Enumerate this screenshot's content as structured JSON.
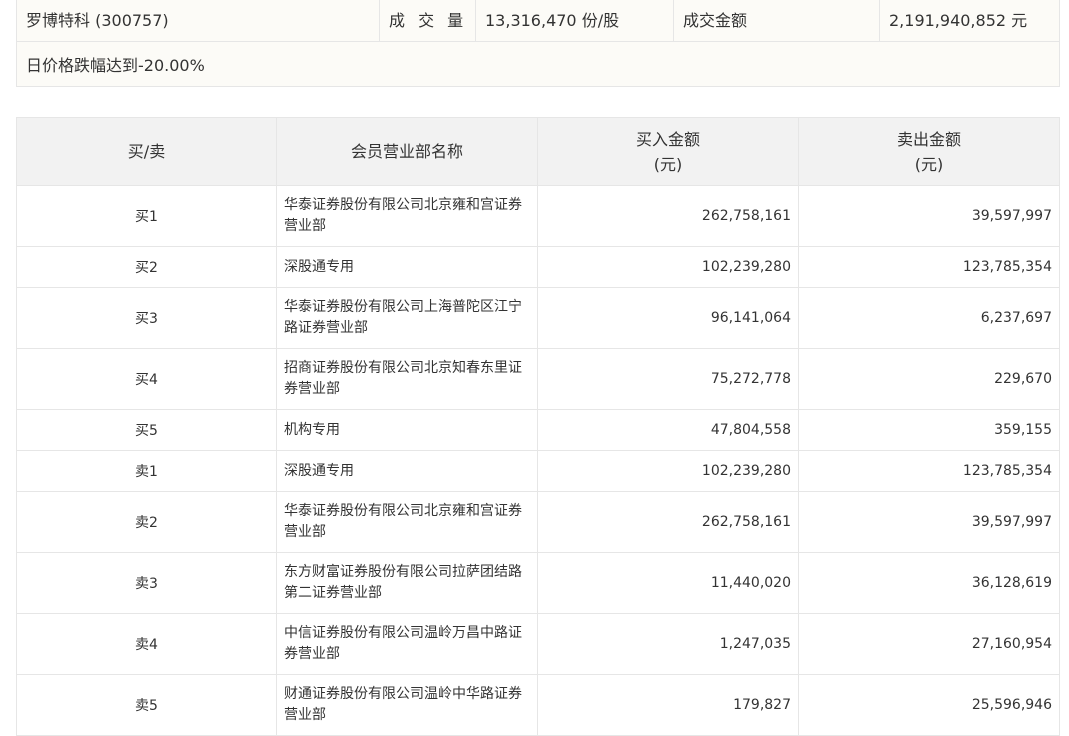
{
  "summary": {
    "stock_name": "罗博特科 (300757)",
    "volume_label": "成 交 量",
    "volume_value": "13,316,470 份/股",
    "amount_label": "成交金额",
    "amount_value": "2,191,940,852 元",
    "reason": "日价格跌幅达到-20.00%"
  },
  "table": {
    "headers": {
      "side": "买/卖",
      "dept": "会员营业部名称",
      "buy": "买入金额",
      "buy_unit": "(元)",
      "sell": "卖出金额",
      "sell_unit": "(元)"
    },
    "rows": [
      {
        "side": "买1",
        "dept": "华泰证券股份有限公司北京雍和宫证券营业部",
        "buy": "262,758,161",
        "sell": "39,597,997"
      },
      {
        "side": "买2",
        "dept": "深股通专用",
        "buy": "102,239,280",
        "sell": "123,785,354"
      },
      {
        "side": "买3",
        "dept": "华泰证券股份有限公司上海普陀区江宁路证券营业部",
        "buy": "96,141,064",
        "sell": "6,237,697"
      },
      {
        "side": "买4",
        "dept": "招商证券股份有限公司北京知春东里证券营业部",
        "buy": "75,272,778",
        "sell": "229,670"
      },
      {
        "side": "买5",
        "dept": "机构专用",
        "buy": "47,804,558",
        "sell": "359,155"
      },
      {
        "side": "卖1",
        "dept": "深股通专用",
        "buy": "102,239,280",
        "sell": "123,785,354"
      },
      {
        "side": "卖2",
        "dept": "华泰证券股份有限公司北京雍和宫证券营业部",
        "buy": "262,758,161",
        "sell": "39,597,997"
      },
      {
        "side": "卖3",
        "dept": "东方财富证券股份有限公司拉萨团结路第二证券营业部",
        "buy": "11,440,020",
        "sell": "36,128,619"
      },
      {
        "side": "卖4",
        "dept": "中信证券股份有限公司温岭万昌中路证券营业部",
        "buy": "1,247,035",
        "sell": "27,160,954"
      },
      {
        "side": "卖5",
        "dept": "财通证券股份有限公司温岭中华路证券营业部",
        "buy": "179,827",
        "sell": "25,596,946"
      }
    ]
  }
}
